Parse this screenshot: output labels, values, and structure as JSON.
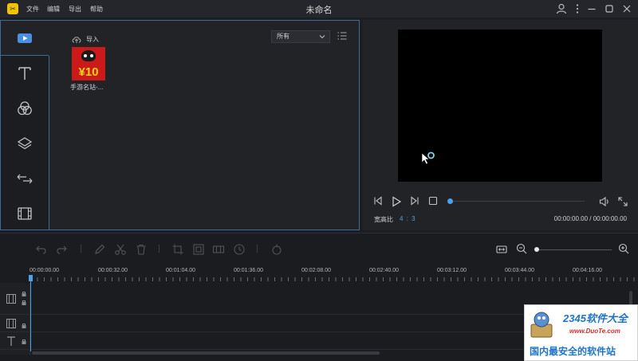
{
  "titlebar": {
    "title": "未命名",
    "menu": [
      "文件",
      "编辑",
      "导出",
      "帮助"
    ],
    "logo_glyph": "✂"
  },
  "media_panel": {
    "import_label": "导入",
    "filter_value": "所有",
    "items": [
      {
        "name": "手游名站-...",
        "thumb_badge": "¥10"
      }
    ],
    "side_tabs": [
      "media-icon",
      "text-icon",
      "filters-icon",
      "overlays-icon",
      "transitions-icon",
      "film-icon"
    ]
  },
  "preview": {
    "aspect_label": "宽高比",
    "aspect_value": "4 : 3",
    "time_readout": "00:00:00.00 / 00:00:00.00",
    "progress": 0
  },
  "timeline": {
    "ticks": [
      "00:00:00.00",
      "00:00:32.00",
      "00:01:04.00",
      "00:01:36.00",
      "00:02:08.00",
      "00:02:40.00",
      "00:03:12.00",
      "00:03:44.00",
      "00:04:16.00"
    ],
    "zoom_level": 0
  },
  "watermark": {
    "brand": "2345软件大全",
    "url": "www.DuoTe.com",
    "slogan": "国内最安全的软件站"
  },
  "colors": {
    "accent": "#4aa3ea",
    "panel_border": "#3c6b9b",
    "background": "#1d1e22"
  }
}
